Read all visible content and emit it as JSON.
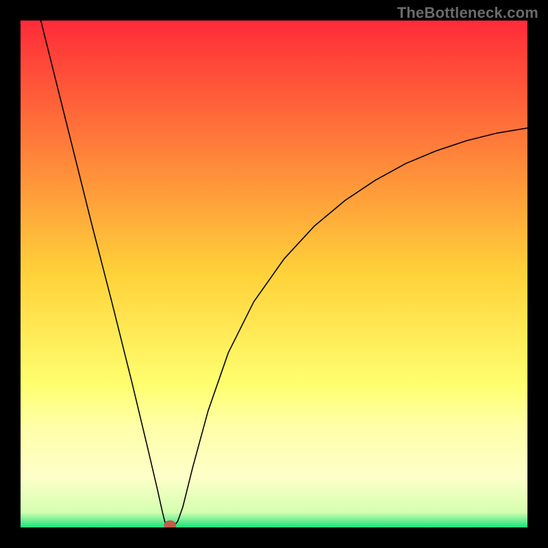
{
  "watermark": "TheBottleneck.com",
  "chart_data": {
    "type": "line",
    "title": "",
    "xlabel": "",
    "ylabel": "",
    "xlim": [
      0,
      100
    ],
    "ylim": [
      0,
      100
    ],
    "grid": false,
    "background_gradient_stops": [
      {
        "offset": 0.0,
        "color": "#ff2b39"
      },
      {
        "offset": 0.5,
        "color": "#ffd23a"
      },
      {
        "offset": 0.72,
        "color": "#ffff70"
      },
      {
        "offset": 0.8,
        "color": "#ffffa8"
      },
      {
        "offset": 0.9,
        "color": "#feffc8"
      },
      {
        "offset": 0.97,
        "color": "#d4ffb0"
      },
      {
        "offset": 1.0,
        "color": "#1ae27a"
      }
    ],
    "marker": {
      "x": 29.5,
      "y": 0.0,
      "rx": 1.2,
      "ry": 1.0,
      "color": "#c55a4d"
    },
    "series": [
      {
        "name": "curve",
        "color": "#000000",
        "width": 1.6,
        "points": [
          {
            "x": 4.0,
            "y": 100.0
          },
          {
            "x": 6.0,
            "y": 92.0
          },
          {
            "x": 10.0,
            "y": 76.0
          },
          {
            "x": 14.0,
            "y": 60.0
          },
          {
            "x": 18.0,
            "y": 44.5
          },
          {
            "x": 22.0,
            "y": 28.5
          },
          {
            "x": 25.0,
            "y": 16.0
          },
          {
            "x": 27.0,
            "y": 7.5
          },
          {
            "x": 28.0,
            "y": 3.0
          },
          {
            "x": 28.5,
            "y": 1.0
          },
          {
            "x": 28.6,
            "y": 0.6
          },
          {
            "x": 30.5,
            "y": 0.6
          },
          {
            "x": 31.0,
            "y": 1.2
          },
          {
            "x": 32.0,
            "y": 4.0
          },
          {
            "x": 34.0,
            "y": 12.0
          },
          {
            "x": 37.0,
            "y": 23.0
          },
          {
            "x": 41.0,
            "y": 34.5
          },
          {
            "x": 46.0,
            "y": 44.5
          },
          {
            "x": 52.0,
            "y": 53.0
          },
          {
            "x": 58.0,
            "y": 59.5
          },
          {
            "x": 64.0,
            "y": 64.5
          },
          {
            "x": 70.0,
            "y": 68.5
          },
          {
            "x": 76.0,
            "y": 71.8
          },
          {
            "x": 82.0,
            "y": 74.3
          },
          {
            "x": 88.0,
            "y": 76.3
          },
          {
            "x": 94.0,
            "y": 77.8
          },
          {
            "x": 100.0,
            "y": 78.8
          }
        ]
      }
    ]
  }
}
